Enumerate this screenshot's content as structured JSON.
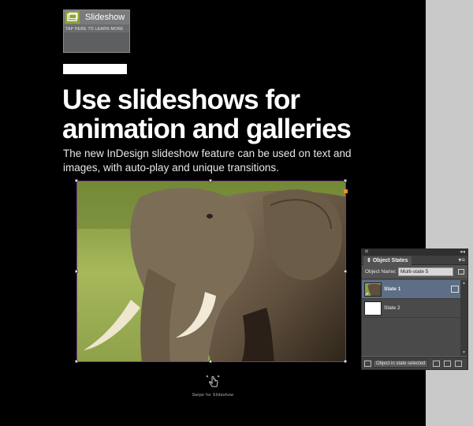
{
  "badge": {
    "title": "Slideshow",
    "subtitle": "TAP HERE TO LEARN MORE",
    "icon": "slideshow-icon",
    "accent": "#8fa334"
  },
  "headline": {
    "line1": "Use slideshows for",
    "line2": "animation and galleries"
  },
  "subtext": {
    "line1": "The new InDesign slideshow feature can be used on text and",
    "line2": "images, with auto-play and unique transitions."
  },
  "photo": {
    "subject": "elephant"
  },
  "swipe": {
    "icon": "touch-swipe-icon",
    "label": "Swipe for Slideshow"
  },
  "panel": {
    "tab": "Object States",
    "object_name_label": "Object Name:",
    "object_name_value": "Multi-state 5",
    "states": [
      {
        "name": "State 1",
        "selected": true
      },
      {
        "name": "State 2",
        "selected": false
      }
    ],
    "footer_label": "Object in state selected"
  },
  "colors": {
    "page_background": "#000000",
    "pasteboard": "#c9c9c9",
    "frame_stroke": "#7a3a8a",
    "anchor": "#f0901c",
    "selected_state": "#5d6e86"
  }
}
